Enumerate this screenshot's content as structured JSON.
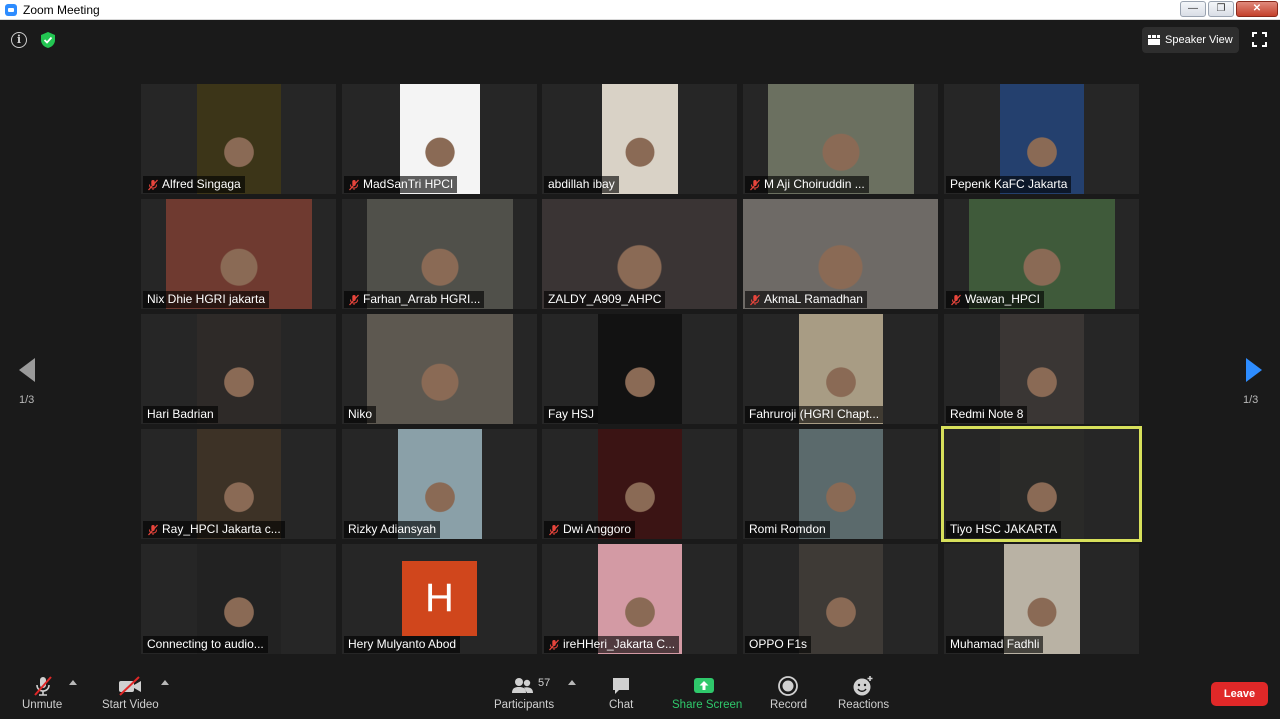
{
  "window": {
    "title": "Zoom Meeting"
  },
  "topbar": {
    "view_label": "Speaker View"
  },
  "pagination": {
    "left_page": "1/3",
    "right_page": "1/3"
  },
  "participants": [
    {
      "name": "Alfred Singaga",
      "muted": true,
      "bg": "#3c3518",
      "vx": 56,
      "vw": 84
    },
    {
      "name": "MadSanTri HPCI",
      "muted": true,
      "bg": "#f4f4f4",
      "vx": 58,
      "vw": 80
    },
    {
      "name": "abdillah ibay",
      "muted": false,
      "bg": "#d9d2c6",
      "vx": 60,
      "vw": 76
    },
    {
      "name": "M Aji Choiruddin ...",
      "muted": true,
      "bg": "#6b7060",
      "vx": 25,
      "vw": 146
    },
    {
      "name": "Pepenk KaFC Jakarta",
      "muted": false,
      "bg": "#24406e",
      "vx": 56,
      "vw": 84
    },
    {
      "name": "Nix Dhie HGRI jakarta",
      "muted": false,
      "bg": "#6f3a30",
      "vx": 25,
      "vw": 146
    },
    {
      "name": "Farhan_Arrab HGRI...",
      "muted": true,
      "bg": "#50504a",
      "vx": 25,
      "vw": 146
    },
    {
      "name": "ZALDY_A909_AHPC",
      "muted": false,
      "bg": "#3a3434",
      "vx": 0,
      "vw": 195
    },
    {
      "name": "AkmaL Ramadhan",
      "muted": true,
      "bg": "#6e6a66",
      "vx": 0,
      "vw": 195
    },
    {
      "name": "Wawan_HPCI",
      "muted": true,
      "bg": "#3f5a3a",
      "vx": 25,
      "vw": 146
    },
    {
      "name": "Hari Badrian",
      "muted": false,
      "bg": "#2e2a28",
      "vx": 56,
      "vw": 84
    },
    {
      "name": "Niko",
      "muted": false,
      "bg": "#5d5850",
      "vx": 25,
      "vw": 146
    },
    {
      "name": "Fay HSJ",
      "muted": false,
      "bg": "#121212",
      "vx": 56,
      "vw": 84
    },
    {
      "name": "Fahruroji (HGRI Chapt...",
      "muted": false,
      "bg": "#a89c84",
      "vx": 56,
      "vw": 84
    },
    {
      "name": "Redmi Note 8",
      "muted": false,
      "bg": "#3a3634",
      "vx": 56,
      "vw": 84
    },
    {
      "name": "Ray_HPCI Jakarta c...",
      "muted": true,
      "bg": "#3d3226",
      "vx": 56,
      "vw": 84
    },
    {
      "name": "Rizky Adiansyah",
      "muted": false,
      "bg": "#8aa0a8",
      "vx": 56,
      "vw": 84
    },
    {
      "name": "Dwi Anggoro",
      "muted": true,
      "bg": "#3b1414",
      "vx": 56,
      "vw": 84
    },
    {
      "name": "Romi Romdon",
      "muted": false,
      "bg": "#5b6a6c",
      "vx": 56,
      "vw": 84
    },
    {
      "name": "Tiyo HSC JAKARTA",
      "muted": false,
      "bg": "#2a2a28",
      "vx": 56,
      "vw": 84
    },
    {
      "name": "Connecting to audio...",
      "muted": false,
      "bg": "#222",
      "vx": 56,
      "vw": 84
    },
    {
      "name": "Hery Mulyanto Abod",
      "muted": false,
      "bg": "#262626",
      "vx": 0,
      "vw": 0,
      "avatar": "H"
    },
    {
      "name": "ireHHeri_Jakarta C...",
      "muted": true,
      "bg": "#d39aa4",
      "vx": 56,
      "vw": 84
    },
    {
      "name": "OPPO F1s",
      "muted": false,
      "bg": "#3e3a36",
      "vx": 56,
      "vw": 84
    },
    {
      "name": "Muhamad Fadhli",
      "muted": false,
      "bg": "#b9b2a4",
      "vx": 60,
      "vw": 76
    }
  ],
  "toolbar": {
    "unmute": "Unmute",
    "start_video": "Start Video",
    "participants": "Participants",
    "participants_count": "57",
    "chat": "Chat",
    "share_screen": "Share Screen",
    "record": "Record",
    "reactions": "Reactions",
    "leave": "Leave"
  },
  "colors": {
    "active_speaker": "#d7e05b",
    "share_green": "#2fc86b",
    "leave_red": "#e02828",
    "avatar_orange": "#d0461c"
  }
}
